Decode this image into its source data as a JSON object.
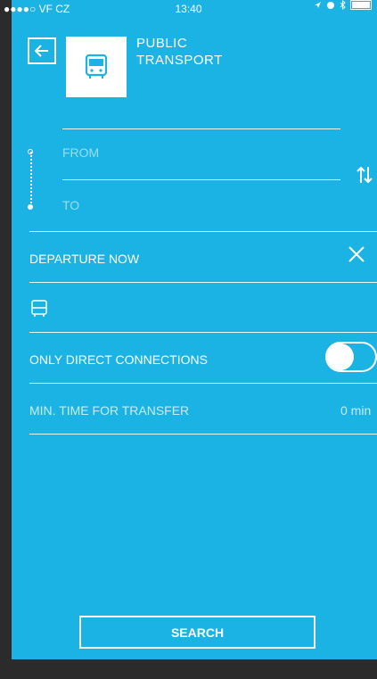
{
  "status_bar": {
    "carrier": "●●●●○ VF CZ",
    "time": "13:40"
  },
  "header": {
    "title_line1": "PUBLIC",
    "title_line2": "TRANSPORT",
    "back_icon": "arrow-left-icon",
    "logo_icon": "bus-icon"
  },
  "route": {
    "from_placeholder": "FROM",
    "to_placeholder": "TO",
    "swap_icon": "swap-vertical-icon"
  },
  "departure": {
    "label": "DEPARTURE NOW",
    "clear_icon": "close-icon"
  },
  "transport_mode": {
    "icon": "bus-icon"
  },
  "direct": {
    "label": "ONLY DIRECT CONNECTIONS",
    "enabled": false
  },
  "transfer": {
    "label": "MIN. TIME FOR TRANSFER",
    "value": "0 min"
  },
  "search": {
    "label": "SEARCH"
  },
  "colors": {
    "background": "#1bb3e3",
    "text": "#ffffff",
    "frame": "#2b2b2b"
  }
}
